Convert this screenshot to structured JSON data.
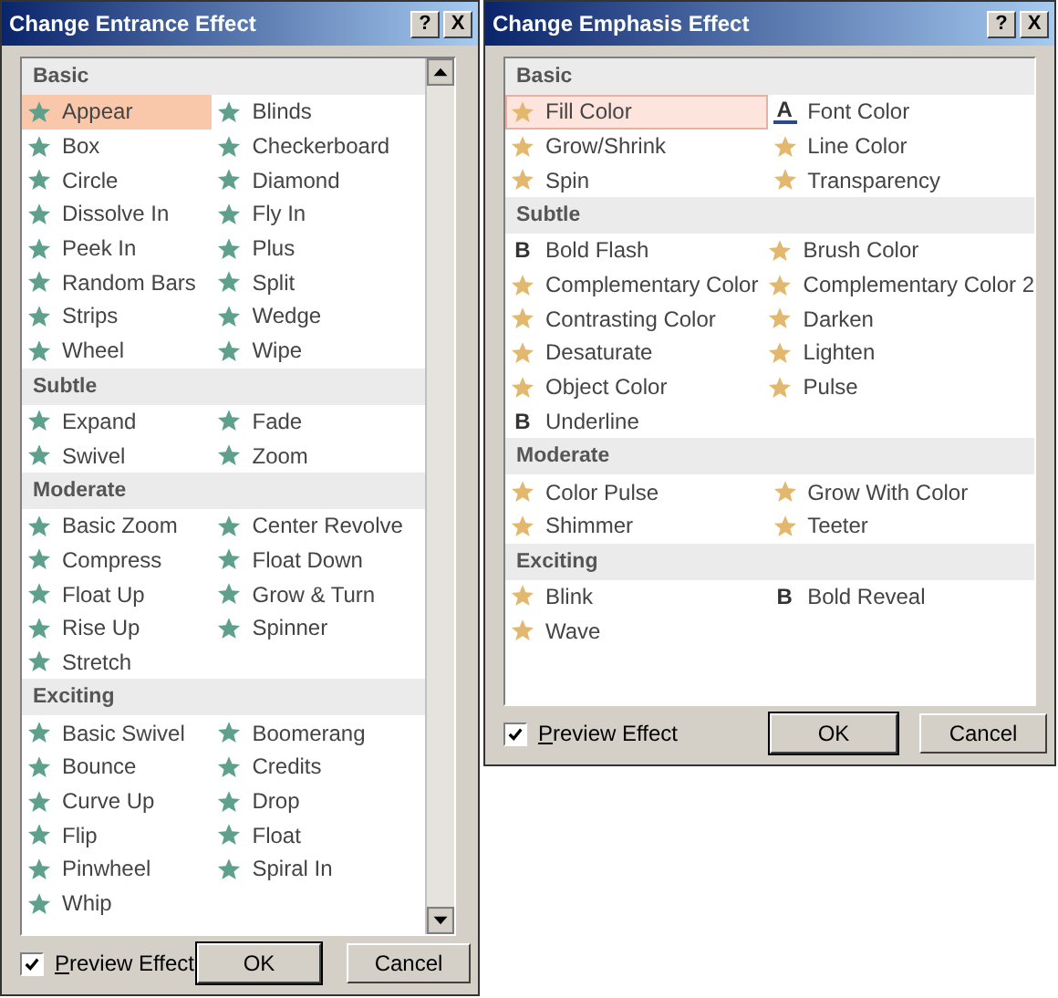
{
  "dialogs": [
    {
      "title": "Change Entrance Effect",
      "title_buttons": [
        "?",
        "X"
      ],
      "color": "#5fa08c",
      "scrollbar": true,
      "sections": [
        {
          "heading": "Basic",
          "items": [
            {
              "label": "Appear",
              "kind": "star",
              "selected": true
            },
            {
              "label": "Blinds",
              "kind": "star",
              "selected": false
            },
            {
              "label": "Box",
              "kind": "star",
              "selected": false
            },
            {
              "label": "Checkerboard",
              "kind": "star",
              "selected": false
            },
            {
              "label": "Circle",
              "kind": "star",
              "selected": false
            },
            {
              "label": "Diamond",
              "kind": "star",
              "selected": false
            },
            {
              "label": "Dissolve In",
              "kind": "star",
              "selected": false
            },
            {
              "label": "Fly In",
              "kind": "star",
              "selected": false
            },
            {
              "label": "Peek In",
              "kind": "star",
              "selected": false
            },
            {
              "label": "Plus",
              "kind": "star",
              "selected": false
            },
            {
              "label": "Random Bars",
              "kind": "star",
              "selected": false
            },
            {
              "label": "Split",
              "kind": "star",
              "selected": false
            },
            {
              "label": "Strips",
              "kind": "star",
              "selected": false
            },
            {
              "label": "Wedge",
              "kind": "star",
              "selected": false
            },
            {
              "label": "Wheel",
              "kind": "star",
              "selected": false
            },
            {
              "label": "Wipe",
              "kind": "star",
              "selected": false
            }
          ]
        },
        {
          "heading": "Subtle",
          "items": [
            {
              "label": "Expand",
              "kind": "star",
              "selected": false
            },
            {
              "label": "Fade",
              "kind": "star",
              "selected": false
            },
            {
              "label": "Swivel",
              "kind": "star",
              "selected": false
            },
            {
              "label": "Zoom",
              "kind": "star",
              "selected": false
            }
          ]
        },
        {
          "heading": "Moderate",
          "items": [
            {
              "label": "Basic Zoom",
              "kind": "star",
              "selected": false
            },
            {
              "label": "Center Revolve",
              "kind": "star",
              "selected": false
            },
            {
              "label": "Compress",
              "kind": "star",
              "selected": false
            },
            {
              "label": "Float Down",
              "kind": "star",
              "selected": false
            },
            {
              "label": "Float Up",
              "kind": "star",
              "selected": false
            },
            {
              "label": "Grow & Turn",
              "kind": "star",
              "selected": false
            },
            {
              "label": "Rise Up",
              "kind": "star",
              "selected": false
            },
            {
              "label": "Spinner",
              "kind": "star",
              "selected": false
            },
            {
              "label": "Stretch",
              "kind": "star",
              "selected": false
            }
          ]
        },
        {
          "heading": "Exciting",
          "items": [
            {
              "label": "Basic Swivel",
              "kind": "star",
              "selected": false
            },
            {
              "label": "Boomerang",
              "kind": "star",
              "selected": false
            },
            {
              "label": "Bounce",
              "kind": "star",
              "selected": false
            },
            {
              "label": "Credits",
              "kind": "star",
              "selected": false
            },
            {
              "label": "Curve Up",
              "kind": "star",
              "selected": false
            },
            {
              "label": "Drop",
              "kind": "star",
              "selected": false
            },
            {
              "label": "Flip",
              "kind": "star",
              "selected": false
            },
            {
              "label": "Float",
              "kind": "star",
              "selected": false
            },
            {
              "label": "Pinwheel",
              "kind": "star",
              "selected": false
            },
            {
              "label": "Spiral In",
              "kind": "star",
              "selected": false
            },
            {
              "label": "Whip",
              "kind": "star",
              "selected": false
            }
          ]
        }
      ],
      "preview": {
        "label": "Preview Effect",
        "checked": true
      },
      "buttons": [
        "OK",
        "Cancel"
      ]
    },
    {
      "title": "Change Emphasis Effect",
      "title_buttons": [
        "?",
        "X"
      ],
      "color": "#e2b86e",
      "scrollbar": false,
      "sections": [
        {
          "heading": "Basic",
          "items": [
            {
              "label": "Fill Color",
              "kind": "star",
              "selected": true
            },
            {
              "label": "Font Color",
              "kind": "letter",
              "glyph": "A",
              "selected": false
            },
            {
              "label": "Grow/Shrink",
              "kind": "star",
              "selected": false
            },
            {
              "label": "Line Color",
              "kind": "star",
              "selected": false
            },
            {
              "label": "Spin",
              "kind": "star",
              "selected": false
            },
            {
              "label": "Transparency",
              "kind": "star",
              "selected": false
            }
          ]
        },
        {
          "heading": "Subtle",
          "items": [
            {
              "label": "Bold Flash",
              "kind": "letter",
              "glyph": "B",
              "selected": false
            },
            {
              "label": "Brush Color",
              "kind": "star",
              "selected": false
            },
            {
              "label": "Complementary Color",
              "kind": "star",
              "selected": false
            },
            {
              "label": "Complementary Color 2",
              "kind": "star",
              "selected": false
            },
            {
              "label": "Contrasting Color",
              "kind": "star",
              "selected": false
            },
            {
              "label": "Darken",
              "kind": "star",
              "selected": false
            },
            {
              "label": "Desaturate",
              "kind": "star",
              "selected": false
            },
            {
              "label": "Lighten",
              "kind": "star",
              "selected": false
            },
            {
              "label": "Object Color",
              "kind": "star",
              "selected": false
            },
            {
              "label": "Pulse",
              "kind": "star",
              "selected": false
            },
            {
              "label": "Underline",
              "kind": "letter",
              "glyph": "B",
              "selected": false
            }
          ]
        },
        {
          "heading": "Moderate",
          "items": [
            {
              "label": "Color Pulse",
              "kind": "star",
              "selected": false
            },
            {
              "label": "Grow With Color",
              "kind": "star",
              "selected": false
            },
            {
              "label": "Shimmer",
              "kind": "star",
              "selected": false
            },
            {
              "label": "Teeter",
              "kind": "star",
              "selected": false
            }
          ]
        },
        {
          "heading": "Exciting",
          "items": [
            {
              "label": "Blink",
              "kind": "star",
              "selected": false
            },
            {
              "label": "Bold Reveal",
              "kind": "letter",
              "glyph": "B",
              "selected": false
            },
            {
              "label": "Wave",
              "kind": "star",
              "selected": false
            }
          ]
        }
      ],
      "preview": {
        "label": "Preview Effect",
        "checked": true
      },
      "buttons": [
        "OK",
        "Cancel"
      ]
    }
  ]
}
